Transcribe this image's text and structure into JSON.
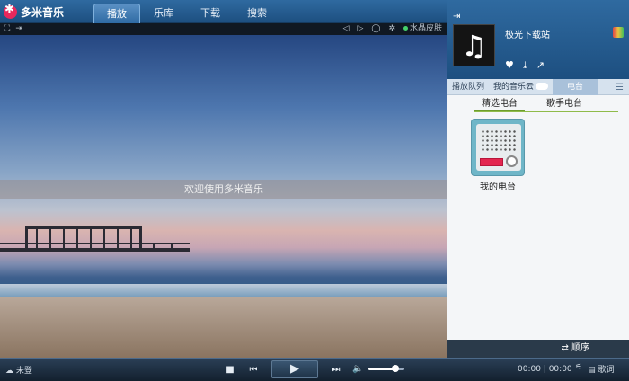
{
  "app": {
    "title": "多米音乐"
  },
  "tabs": [
    {
      "label": "播放",
      "active": true
    },
    {
      "label": "乐库",
      "active": false
    },
    {
      "label": "下载",
      "active": false
    },
    {
      "label": "搜索",
      "active": false
    }
  ],
  "video_toolbar": {
    "skin_label": "水晶皮肤"
  },
  "video": {
    "welcome_text": "欢迎使用多米音乐"
  },
  "now_playing": {
    "title": "极光下载站"
  },
  "panel_tabs": [
    {
      "label": "播放队列",
      "active": false
    },
    {
      "label": "我的音乐云",
      "active": false
    },
    {
      "label": "电台",
      "active": true
    }
  ],
  "sub_tabs": [
    {
      "label": "精选电台",
      "active": true
    },
    {
      "label": "歌手电台",
      "active": false
    }
  ],
  "stations": [
    {
      "label": "我的电台"
    }
  ],
  "order_button": {
    "label": "顺序"
  },
  "controls": {
    "mode_label": "未登",
    "time_current": "00:00",
    "time_total": "00:00",
    "lyrics_label": "歌词",
    "volume_fraction": 0.75
  },
  "colors": {
    "accent": "#e8285c",
    "station_red": "#e3264f",
    "active_green": "#6d9d2d"
  }
}
